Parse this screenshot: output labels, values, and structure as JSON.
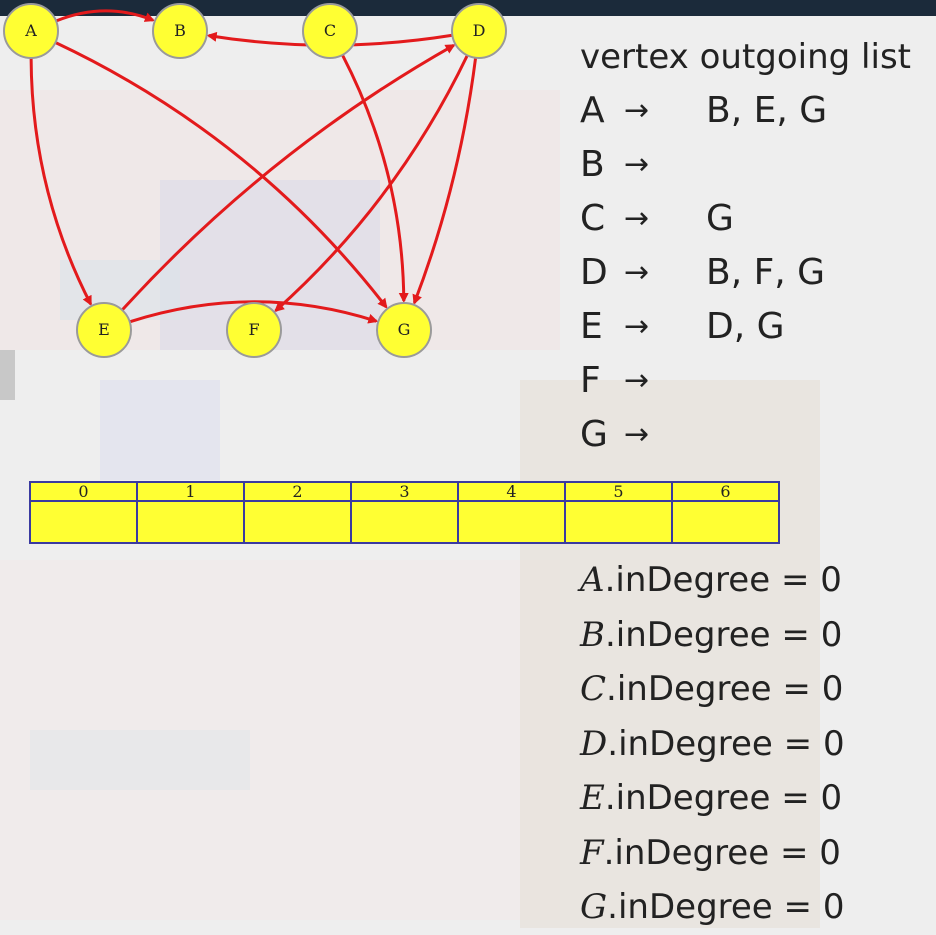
{
  "graph": {
    "nodes": [
      {
        "id": "A",
        "label": "A"
      },
      {
        "id": "B",
        "label": "B"
      },
      {
        "id": "C",
        "label": "C"
      },
      {
        "id": "D",
        "label": "D"
      },
      {
        "id": "E",
        "label": "E"
      },
      {
        "id": "F",
        "label": "F"
      },
      {
        "id": "G",
        "label": "G"
      }
    ],
    "edges": [
      {
        "from": "A",
        "to": "B"
      },
      {
        "from": "A",
        "to": "E"
      },
      {
        "from": "A",
        "to": "G"
      },
      {
        "from": "C",
        "to": "G"
      },
      {
        "from": "D",
        "to": "B"
      },
      {
        "from": "D",
        "to": "F"
      },
      {
        "from": "D",
        "to": "G"
      },
      {
        "from": "E",
        "to": "D"
      },
      {
        "from": "E",
        "to": "G"
      }
    ],
    "node_color": "#ffff33",
    "edge_color": "#e31a1c"
  },
  "outgoing": {
    "header": "vertex outgoing list",
    "arrow": "→",
    "rows": [
      {
        "vertex": "A",
        "list": "B, E, G"
      },
      {
        "vertex": "B",
        "list": ""
      },
      {
        "vertex": "C",
        "list": "G"
      },
      {
        "vertex": "D",
        "list": "B, F, G"
      },
      {
        "vertex": "E",
        "list": "D, G"
      },
      {
        "vertex": "F",
        "list": ""
      },
      {
        "vertex": "G",
        "list": ""
      }
    ]
  },
  "array": {
    "indices": [
      "0",
      "1",
      "2",
      "3",
      "4",
      "5",
      "6"
    ],
    "cells": [
      "",
      "",
      "",
      "",
      "",
      "",
      ""
    ]
  },
  "indegree": {
    "suffix": ".inDegree",
    "equals": "=",
    "rows": [
      {
        "vertex": "A",
        "value": "0"
      },
      {
        "vertex": "B",
        "value": "0"
      },
      {
        "vertex": "C",
        "value": "0"
      },
      {
        "vertex": "D",
        "value": "0"
      },
      {
        "vertex": "E",
        "value": "0"
      },
      {
        "vertex": "F",
        "value": "0"
      },
      {
        "vertex": "G",
        "value": "0"
      }
    ]
  }
}
